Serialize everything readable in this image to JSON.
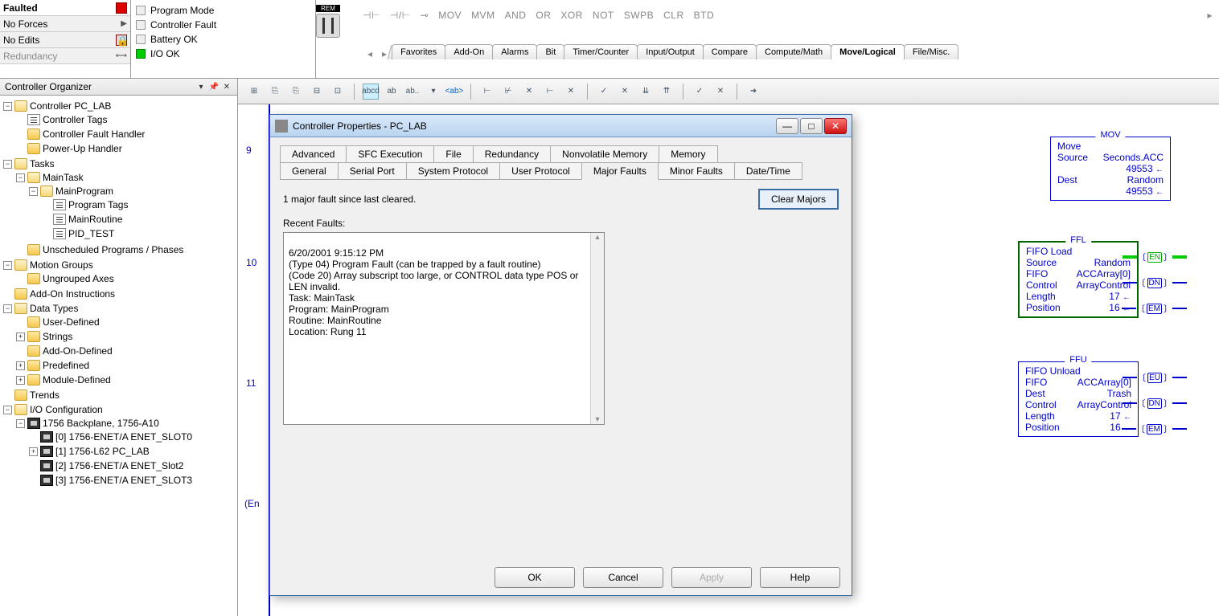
{
  "status": {
    "faulted": "Faulted",
    "forces": "No Forces",
    "edits": "No Edits",
    "redundancy": "Redundancy"
  },
  "checks": {
    "program_mode": "Program Mode",
    "controller_fault": "Controller Fault",
    "battery_ok": "Battery OK",
    "io_ok": "I/O OK"
  },
  "rem_label": "REM",
  "toolbar_ops": [
    "MOV",
    "MVM",
    "AND",
    "OR",
    "XOR",
    "NOT",
    "SWPB",
    "CLR",
    "BTD"
  ],
  "tabs": [
    "Favorites",
    "Add-On",
    "Alarms",
    "Bit",
    "Timer/Counter",
    "Input/Output",
    "Compare",
    "Compute/Math",
    "Move/Logical",
    "File/Misc."
  ],
  "active_tab": "Move/Logical",
  "organizer_title": "Controller Organizer",
  "tree": {
    "controller": "Controller PC_LAB",
    "controller_tags": "Controller Tags",
    "fault_handler": "Controller Fault Handler",
    "powerup": "Power-Up Handler",
    "tasks": "Tasks",
    "maintask": "MainTask",
    "mainprogram": "MainProgram",
    "program_tags": "Program Tags",
    "mainroutine": "MainRoutine",
    "pid_test": "PID_TEST",
    "unscheduled": "Unscheduled Programs / Phases",
    "motion": "Motion Groups",
    "ungrouped": "Ungrouped Axes",
    "addon": "Add-On Instructions",
    "datatypes": "Data Types",
    "userdef": "User-Defined",
    "strings": "Strings",
    "addondef": "Add-On-Defined",
    "predef": "Predefined",
    "moddef": "Module-Defined",
    "trends": "Trends",
    "ioconfig": "I/O Configuration",
    "backplane": "1756 Backplane, 1756-A10",
    "slot0": "[0] 1756-ENET/A ENET_SLOT0",
    "slot1": "[1] 1756-L62 PC_LAB",
    "slot2": "[2] 1756-ENET/A ENET_Slot2",
    "slot3": "[3] 1756-ENET/A ENET_SLOT3"
  },
  "rungs": {
    "r9": "9",
    "r10": "10",
    "r11": "11",
    "end": "(En"
  },
  "mov": {
    "title": "MOV",
    "name": "Move",
    "src_label": "Source",
    "src_val": "Seconds.ACC",
    "src_num": "49553",
    "dest_label": "Dest",
    "dest_val": "Random",
    "dest_num": "49553"
  },
  "ffl": {
    "title": "FFL",
    "name": "FIFO Load",
    "src_label": "Source",
    "src_val": "Random",
    "fifo_label": "FIFO",
    "fifo_val": "ACCArray[0]",
    "ctrl_label": "Control",
    "ctrl_val": "ArrayControl",
    "len_label": "Length",
    "len_val": "17",
    "pos_label": "Position",
    "pos_val": "16",
    "en": "EN",
    "dn": "DN",
    "em": "EM"
  },
  "ffu": {
    "title": "FFU",
    "name": "FIFO Unload",
    "fifo_label": "FIFO",
    "fifo_val": "ACCArray[0]",
    "dest_label": "Dest",
    "dest_val": "Trash",
    "ctrl_label": "Control",
    "ctrl_val": "ArrayControl",
    "len_label": "Length",
    "len_val": "17",
    "pos_label": "Position",
    "pos_val": "16",
    "eu": "EU",
    "dn": "DN",
    "em": "EM"
  },
  "dialog": {
    "title": "Controller Properties - PC_LAB",
    "tabs_row1": [
      "Advanced",
      "SFC Execution",
      "File",
      "Redundancy",
      "Nonvolatile Memory",
      "Memory"
    ],
    "tabs_row2": [
      "General",
      "Serial Port",
      "System Protocol",
      "User Protocol",
      "Major Faults",
      "Minor Faults",
      "Date/Time"
    ],
    "active": "Major Faults",
    "summary": "1 major fault since last cleared.",
    "clear": "Clear Majors",
    "recent_label": "Recent Faults:",
    "fault_text": "6/20/2001 9:15:12 PM\n(Type 04) Program Fault (can be trapped by a fault routine)\n(Code 20) Array subscript too large, or CONTROL data type POS or LEN invalid.\nTask:        MainTask\nProgram:  MainProgram\nRoutine:   MainRoutine\nLocation:  Rung 11",
    "ok": "OK",
    "cancel": "Cancel",
    "apply": "Apply",
    "help": "Help"
  }
}
